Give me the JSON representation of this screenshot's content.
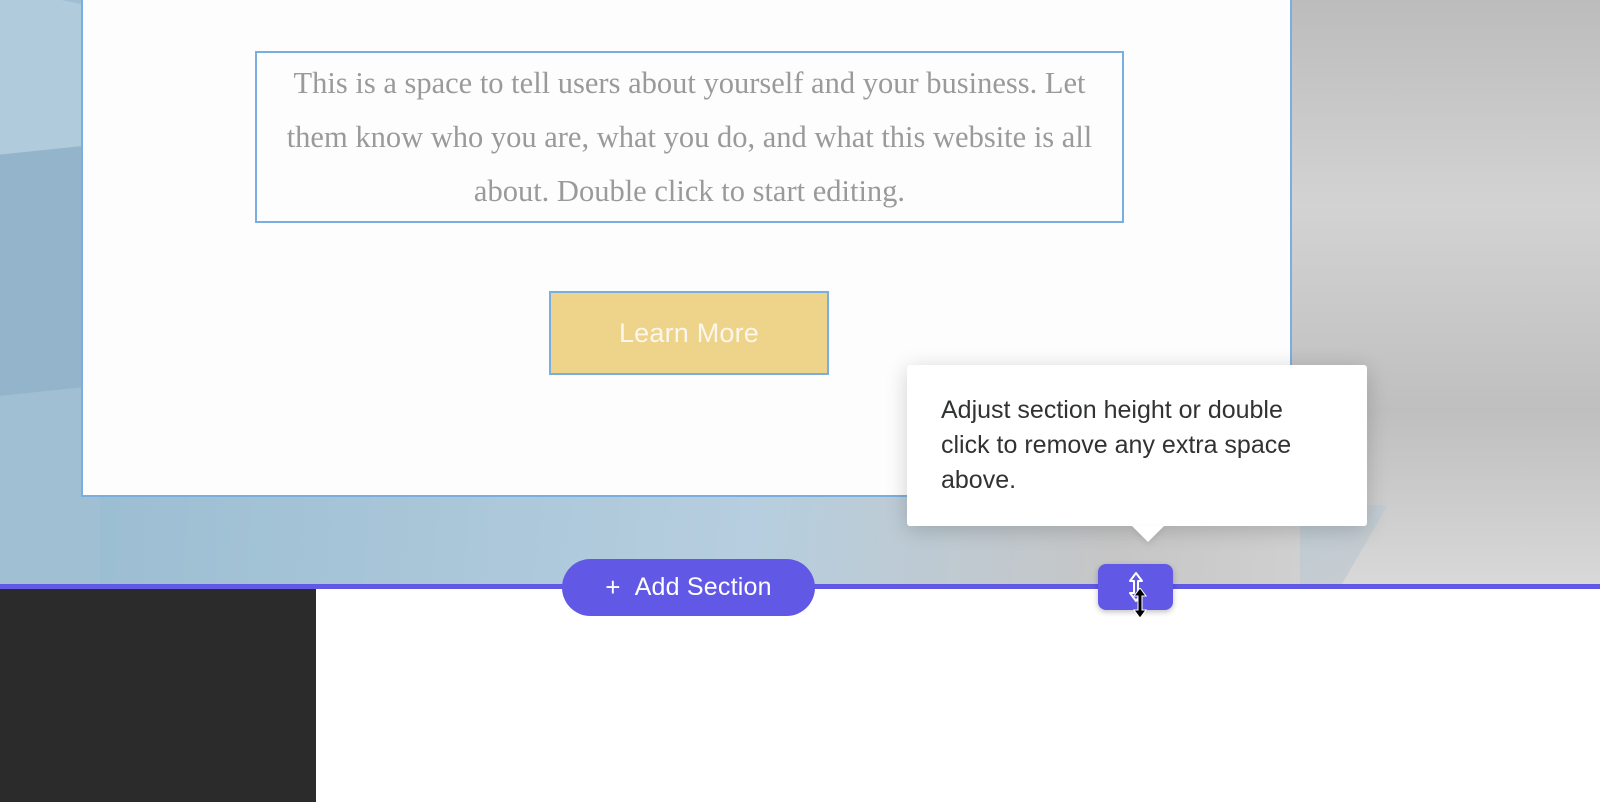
{
  "content": {
    "paragraph": "This is a space to tell users about yourself and your business. Let them know who you are, what you do, and what this website is all about. Double click to start editing.",
    "learn_more_label": "Learn More"
  },
  "editor": {
    "add_section_label": "Add Section",
    "height_tooltip": "Adjust section height or double click to remove any extra space above."
  },
  "colors": {
    "accent": "#6158e6",
    "button_bg": "#eed38b",
    "selection_outline": "#79aee0"
  }
}
